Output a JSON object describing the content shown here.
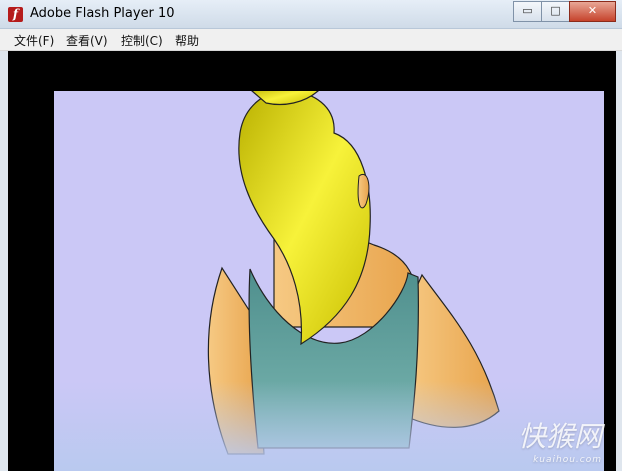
{
  "window": {
    "title": "Adobe Flash Player 10",
    "minimize": "▭",
    "maximize": "□",
    "close": "✕"
  },
  "menu": [
    "文件(F)",
    "查看(V)",
    "控制(C)",
    "帮助"
  ],
  "watermark": {
    "text": "快猴网",
    "sub": "kuaihou.com"
  },
  "colors": {
    "stage": "#000000",
    "scene_bg": "#cbc8f6",
    "hair": "#d6d316",
    "tank": "#5f9f9b",
    "skin": "#f2b867"
  }
}
